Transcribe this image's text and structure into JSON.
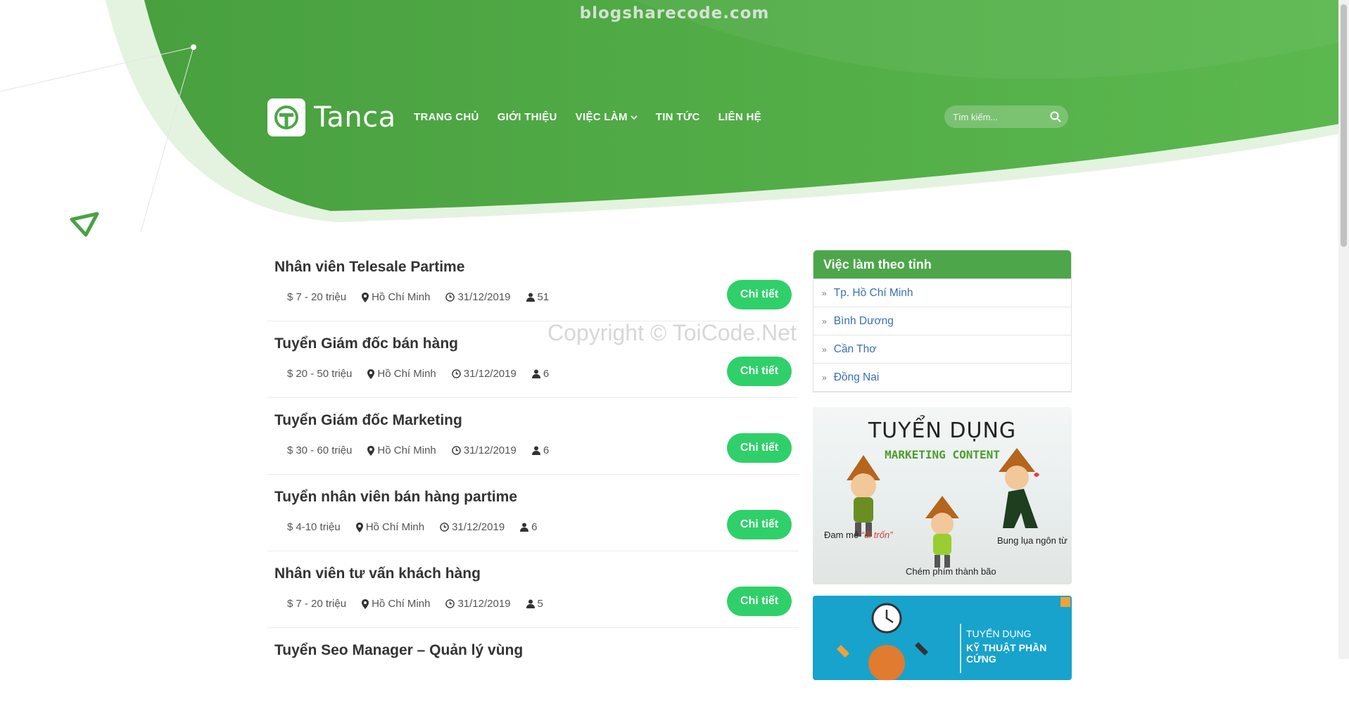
{
  "watermark_top": "blogsharecode.com",
  "watermark_copyright": "Copyright © ToiCode.Net",
  "brand": {
    "name": "Tanca"
  },
  "nav": [
    {
      "label": "TRANG CHỦ"
    },
    {
      "label": "GIỚI THIỆU"
    },
    {
      "label": "VIỆC LÀM",
      "dropdown": true
    },
    {
      "label": "TIN TỨC"
    },
    {
      "label": "LIÊN HỆ"
    }
  ],
  "search": {
    "placeholder": "Tìm kiếm...",
    "value": ""
  },
  "jobs": [
    {
      "title": "Nhân viên Telesale Partime",
      "salary": "7 - 20 triệu",
      "location": "Hồ Chí Minh",
      "deadline": "31/12/2019",
      "count": "51",
      "button": "Chi tiết"
    },
    {
      "title": "Tuyển Giám đốc bán hàng",
      "salary": "20 - 50 triệu",
      "location": "Hồ Chí Minh",
      "deadline": "31/12/2019",
      "count": "6",
      "button": "Chi tiết"
    },
    {
      "title": "Tuyển Giám đốc Marketing",
      "salary": "30 - 60 triệu",
      "location": "Hồ Chí Minh",
      "deadline": "31/12/2019",
      "count": "6",
      "button": "Chi tiết"
    },
    {
      "title": "Tuyển nhân viên bán hàng partime",
      "salary": "4-10 triệu",
      "location": "Hồ Chí Minh",
      "deadline": "31/12/2019",
      "count": "6",
      "button": "Chi tiết"
    },
    {
      "title": "Nhân viên tư vấn khách hàng",
      "salary": "7 - 20 triệu",
      "location": "Hồ Chí Minh",
      "deadline": "31/12/2019",
      "count": "5",
      "button": "Chi tiết"
    },
    {
      "title": "Tuyển Seo Manager – Quản lý vùng"
    }
  ],
  "sidebar": {
    "title": "Việc làm theo tỉnh",
    "provinces": [
      "Tp. Hồ Chí Minh",
      "Bình Dương",
      "Cần Thơ",
      "Đồng Nai"
    ]
  },
  "ad_marketing": {
    "title": "TUYỂN DỤNG",
    "subtitle": "MARKETING CONTENT",
    "caption_left_prefix": "Đam mê ",
    "caption_left_highlight": "“đi trốn”",
    "caption_center": "Chém phím thành bão",
    "caption_right": "Bung lụa ngôn từ"
  },
  "ad_hardware": {
    "line1": "TUYỂN DỤNG",
    "line2": "KỸ THUẬT PHẦN CỨNG"
  },
  "colors": {
    "brand_green": "#4da64a",
    "button_green": "#2fd06a",
    "link_blue": "#3a6fb4"
  }
}
